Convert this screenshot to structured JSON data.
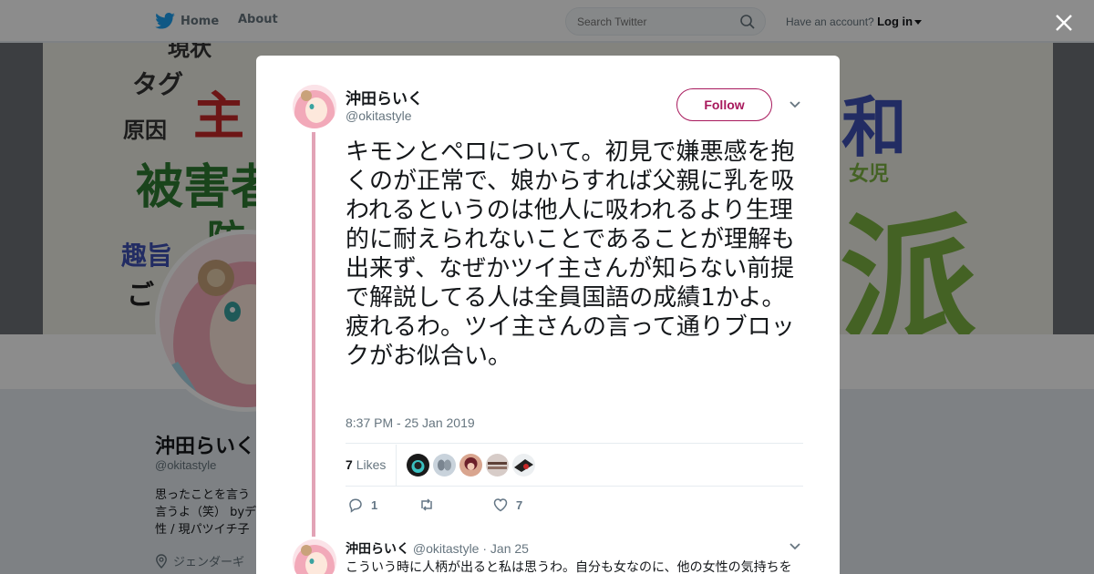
{
  "nav": {
    "home_label": "Home",
    "about_label": "About",
    "search_placeholder": "Search Twitter",
    "account_prompt": "Have an account?",
    "login_label": "Log in"
  },
  "banner": {
    "words": [
      "現状",
      "タグ",
      "主",
      "原因",
      "被害者",
      "防",
      "趣旨",
      "ご",
      "和",
      "女児",
      "派"
    ]
  },
  "profile": {
    "name": "沖田らいく",
    "handle": "@okitastyle",
    "bio_lines": [
      "思ったことを言う",
      "言うよ（笑） byデ",
      "性 / 現パツイチ子"
    ],
    "location": "ジェンダーギ"
  },
  "tweet": {
    "author_name": "沖田らいく",
    "author_handle": "@okitastyle",
    "follow_label": "Follow",
    "text": "キモンとペロについて。初見で嫌悪感を抱くのが正常で、娘からすれば父親に乳を吸われるというのは他人に吸われるより生理的に耐えられないことであることが理解も出来ず、なぜかツイ主さんが知らない前提で解説してる人は全員国語の成績1かよ。疲れるわ。ツイ主さんの言って通りブロックがお似合い。",
    "timestamp": "8:37 PM - 25 Jan 2019",
    "likes_count": "7",
    "likes_label": "Likes",
    "reply_count": "1",
    "retweet_count": "",
    "like_count": "7"
  },
  "reply": {
    "author_name": "沖田らいく",
    "author_handle": "@okitastyle",
    "date": "· Jan 25",
    "text": "こういう時に人柄が出ると私は思うわ。自分も女なのに、他の女性の気持ちを"
  },
  "colors": {
    "accent": "#a8195c",
    "thread": "#e2a3b6",
    "twitter_blue": "#1da1f2"
  }
}
